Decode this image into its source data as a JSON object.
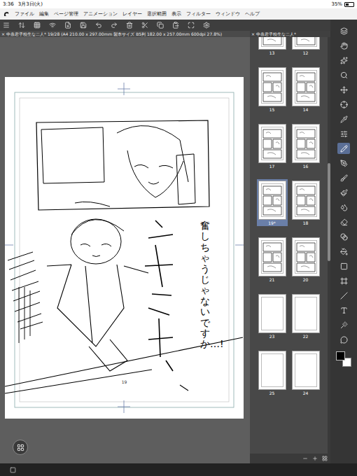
{
  "status_bar": {
    "time": "3:36",
    "date": "3月3日(火)",
    "battery": "35%",
    "battery_level": 0.35
  },
  "menu": [
    "ファイル",
    "編集",
    "ページ管理",
    "アニメーション",
    "レイヤー",
    "選択範囲",
    "表示",
    "フィルター",
    "ウィンドウ",
    "ヘルプ"
  ],
  "document_tab": {
    "close": "×",
    "title": "中条君子校生な二人* 19/28 (A4 210.00 x 297.00mm 製本サイズ B5判 182.00 x 257.00mm 600dpi 27.8%)"
  },
  "page_panel": {
    "close": "×",
    "title": "中条君子校生な二人*",
    "spreads": [
      [
        {
          "label": "13",
          "selected": false,
          "kind": "drawn"
        },
        {
          "label": "12",
          "selected": false,
          "kind": "drawn"
        }
      ],
      [
        {
          "label": "15",
          "selected": false,
          "kind": "drawn"
        },
        {
          "label": "14",
          "selected": false,
          "kind": "drawn"
        }
      ],
      [
        {
          "label": "17",
          "selected": false,
          "kind": "drawn"
        },
        {
          "label": "16",
          "selected": false,
          "kind": "drawn"
        }
      ],
      [
        {
          "label": "19*",
          "selected": true,
          "kind": "drawn"
        },
        {
          "label": "18",
          "selected": false,
          "kind": "drawn"
        }
      ],
      [
        {
          "label": "21",
          "selected": false,
          "kind": "drawn"
        },
        {
          "label": "20",
          "selected": false,
          "kind": "drawn"
        }
      ],
      [
        {
          "label": "23",
          "selected": false,
          "kind": "blank"
        },
        {
          "label": "22",
          "selected": false,
          "kind": "blank"
        }
      ],
      [
        {
          "label": "25",
          "selected": false,
          "kind": "blank"
        },
        {
          "label": "24",
          "selected": false,
          "kind": "blank"
        }
      ]
    ]
  },
  "canvas": {
    "page_number": "19",
    "dialogue": "奮しちゃうじゃないですか…!"
  },
  "tools": [
    {
      "selected": false
    },
    {
      "selected": false
    },
    {
      "selected": false
    },
    {
      "selected": false
    },
    {
      "selected": false
    },
    {
      "selected": false
    },
    {
      "selected": false
    },
    {
      "selected": false
    },
    {
      "selected": true
    },
    {
      "selected": false
    },
    {
      "selected": false
    },
    {
      "selected": false
    },
    {
      "selected": false
    },
    {
      "selected": false
    },
    {
      "selected": false
    },
    {
      "selected": false
    },
    {
      "selected": false
    },
    {
      "selected": false
    },
    {
      "selected": false
    },
    {
      "selected": false
    },
    {
      "selected": false
    },
    {
      "selected": false
    }
  ],
  "colors": {
    "main": "#000000",
    "sub": "#ffffff"
  }
}
